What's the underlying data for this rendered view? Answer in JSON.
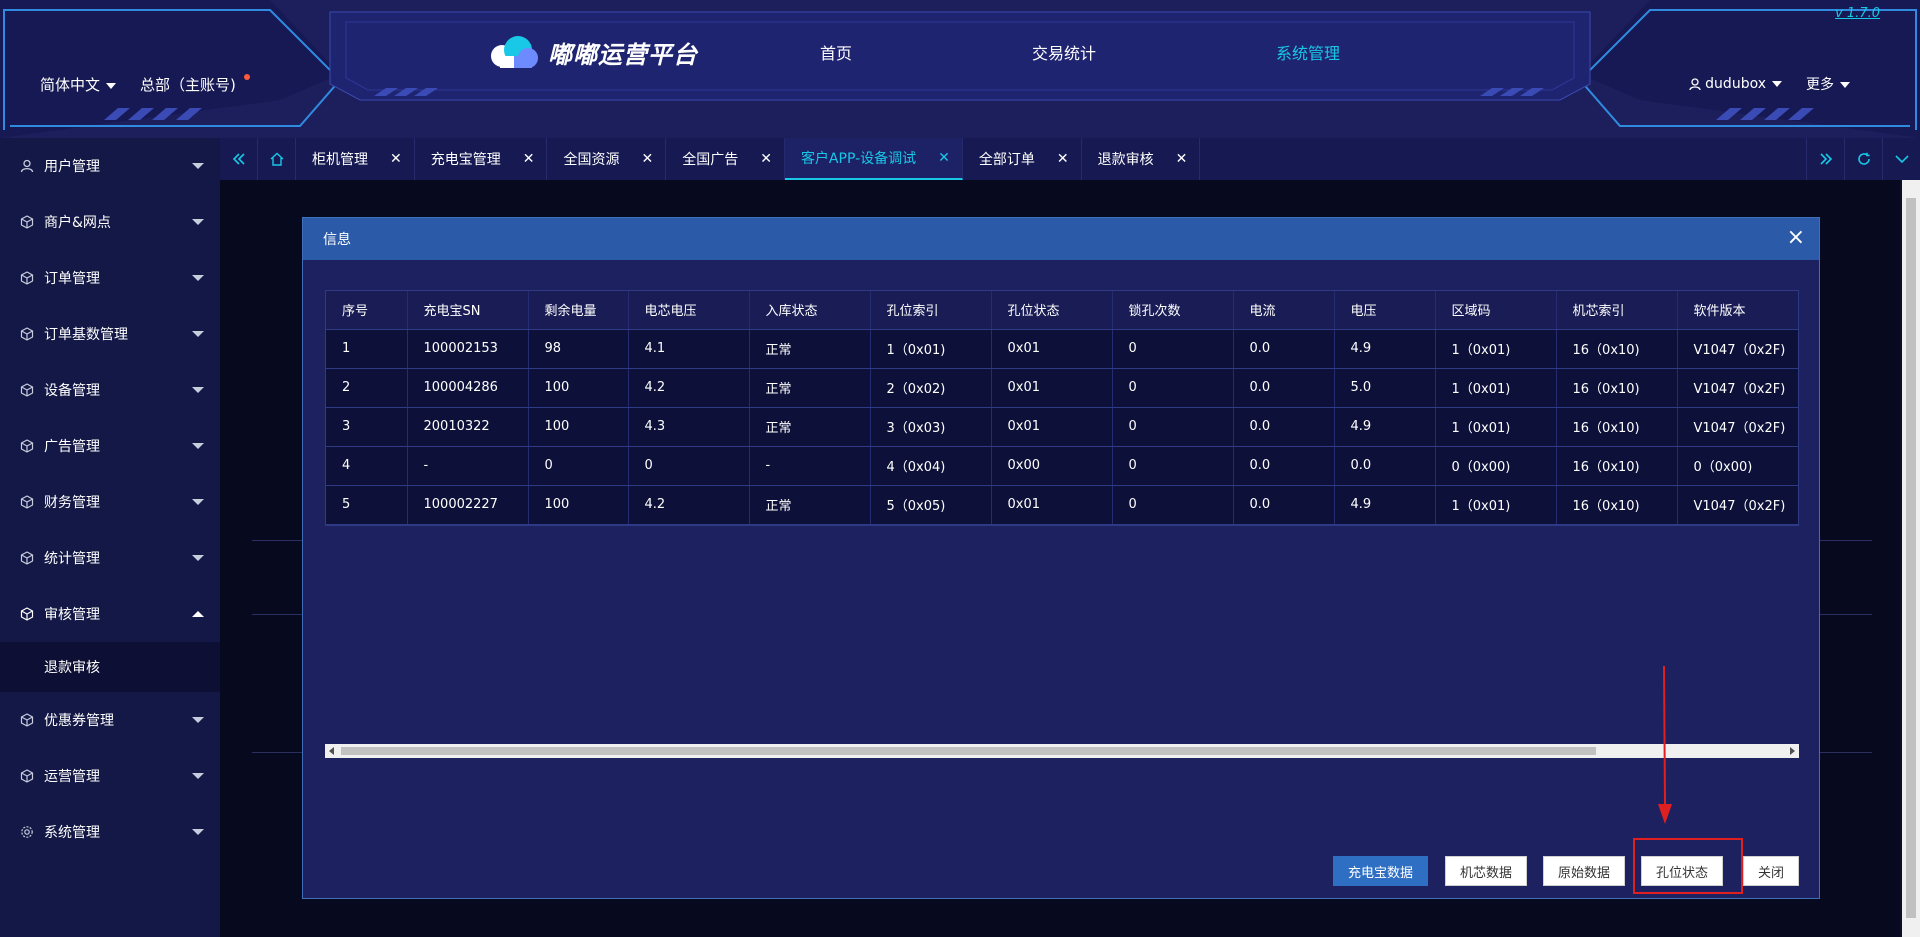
{
  "header": {
    "version": "v 1.7.0",
    "logo_text": "嘟嘟运营平台",
    "nav": [
      "首页",
      "交易统计",
      "系统管理"
    ],
    "active_nav": "系统管理",
    "language": "简体中文",
    "account": "总部（主账号)",
    "user": "dudubox",
    "more": "更多"
  },
  "sidebar": {
    "items": [
      {
        "label": "用户管理",
        "icon": "user-icon"
      },
      {
        "label": "商户&网点",
        "icon": "cube-icon"
      },
      {
        "label": "订单管理",
        "icon": "cube-icon"
      },
      {
        "label": "订单基数管理",
        "icon": "cube-icon"
      },
      {
        "label": "设备管理",
        "icon": "cube-icon"
      },
      {
        "label": "广告管理",
        "icon": "cube-icon"
      },
      {
        "label": "财务管理",
        "icon": "cube-icon"
      },
      {
        "label": "统计管理",
        "icon": "cube-icon"
      },
      {
        "label": "审核管理",
        "icon": "cube-icon",
        "expanded": true
      },
      {
        "label": "优惠券管理",
        "icon": "cube-icon"
      },
      {
        "label": "运营管理",
        "icon": "cube-icon"
      },
      {
        "label": "系统管理",
        "icon": "gear-icon"
      }
    ],
    "subitem": "退款审核"
  },
  "tabs": [
    {
      "label": "柜机管理"
    },
    {
      "label": "充电宝管理"
    },
    {
      "label": "全国资源"
    },
    {
      "label": "全国广告"
    },
    {
      "label": "客户APP-设备调试",
      "active": true
    },
    {
      "label": "全部订单"
    },
    {
      "label": "退款审核"
    }
  ],
  "modal": {
    "title": "信息",
    "columns": [
      "序号",
      "充电宝SN",
      "剩余电量",
      "电芯电压",
      "入库状态",
      "孔位索引",
      "孔位状态",
      "锁孔次数",
      "电流",
      "电压",
      "区域码",
      "机芯索引",
      "软件版本"
    ],
    "rows": [
      [
        "1",
        "100002153",
        "98",
        "4.1",
        "正常",
        "1（0x01)",
        "0x01",
        "0",
        "0.0",
        "4.9",
        "1（0x01)",
        "16（0x10)",
        "V1047（0x2F)"
      ],
      [
        "2",
        "100004286",
        "100",
        "4.2",
        "正常",
        "2（0x02)",
        "0x01",
        "0",
        "0.0",
        "5.0",
        "1（0x01)",
        "16（0x10)",
        "V1047（0x2F)"
      ],
      [
        "3",
        "20010322",
        "100",
        "4.3",
        "正常",
        "3（0x03)",
        "0x01",
        "0",
        "0.0",
        "4.9",
        "1（0x01)",
        "16（0x10)",
        "V1047（0x2F)"
      ],
      [
        "4",
        "-",
        "0",
        "0",
        "-",
        "4（0x04)",
        "0x00",
        "0",
        "0.0",
        "0.0",
        "0（0x00)",
        "16（0x10)",
        "0（0x00)"
      ],
      [
        "5",
        "100002227",
        "100",
        "4.2",
        "正常",
        "5（0x05)",
        "0x01",
        "0",
        "0.0",
        "4.9",
        "1（0x01)",
        "16（0x10)",
        "V1047（0x2F)"
      ]
    ],
    "buttons": {
      "powerbank_data": "充电宝数据",
      "core_data": "机芯数据",
      "raw_data": "原始数据",
      "slot_status": "孔位状态",
      "close": "关闭"
    }
  },
  "colors": {
    "accent": "#19c7e6",
    "header_bg": "#1c1f5c",
    "modal_head": "#2b5ba8",
    "primary_button": "#2e6fc4",
    "annotation": "#e02020"
  }
}
